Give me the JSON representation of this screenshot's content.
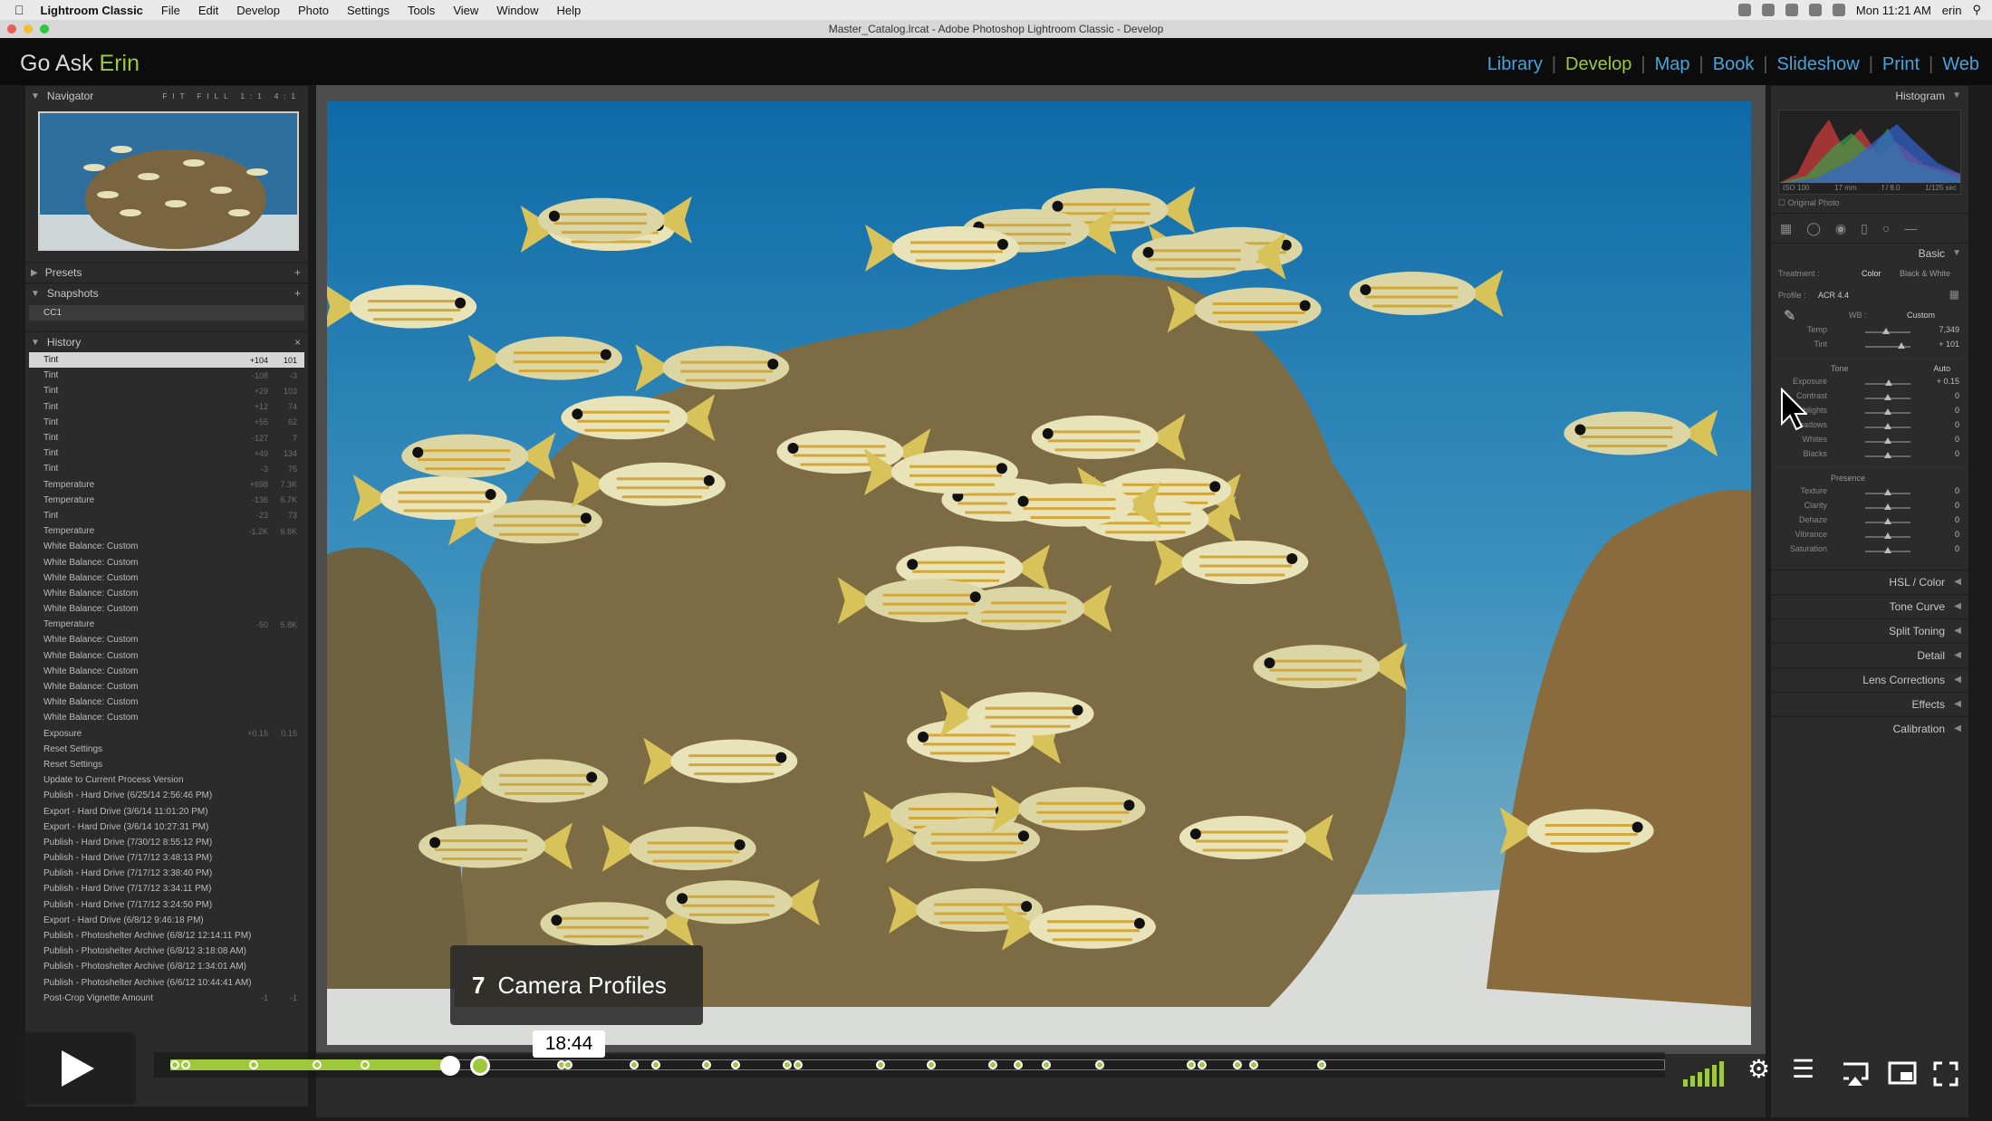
{
  "menubar": {
    "app_name": "Lightroom Classic",
    "items": [
      "File",
      "Edit",
      "Develop",
      "Photo",
      "Settings",
      "Tools",
      "View",
      "Window",
      "Help"
    ],
    "clock": "Mon 11:21 AM",
    "user": "erin"
  },
  "window_title": "Master_Catalog.lrcat - Adobe Photoshop Lightroom Classic - Develop",
  "brand": {
    "prefix": "Go Ask ",
    "accent": "Erin"
  },
  "modules": [
    "Library",
    "Develop",
    "Map",
    "Book",
    "Slideshow",
    "Print",
    "Web"
  ],
  "active_module": "Develop",
  "left_panel": {
    "navigator": {
      "title": "Navigator",
      "zoom_options": [
        "FIT",
        "FILL",
        "1:1",
        "4:1"
      ]
    },
    "presets_title": "Presets",
    "snapshots": {
      "title": "Snapshots",
      "items": [
        "CC1"
      ]
    },
    "history": {
      "title": "History",
      "items": [
        {
          "name": "Tint",
          "v1": "+104",
          "v2": "101"
        },
        {
          "name": "Tint",
          "v1": "-108",
          "v2": "-3"
        },
        {
          "name": "Tint",
          "v1": "+29",
          "v2": "103"
        },
        {
          "name": "Tint",
          "v1": "+12",
          "v2": "74"
        },
        {
          "name": "Tint",
          "v1": "+55",
          "v2": "62"
        },
        {
          "name": "Tint",
          "v1": "-127",
          "v2": "7"
        },
        {
          "name": "Tint",
          "v1": "+49",
          "v2": "134"
        },
        {
          "name": "Tint",
          "v1": "-3",
          "v2": "75"
        },
        {
          "name": "Temperature",
          "v1": "+698",
          "v2": "7.3K"
        },
        {
          "name": "Temperature",
          "v1": "-136",
          "v2": "6.7K"
        },
        {
          "name": "Tint",
          "v1": "-23",
          "v2": "73"
        },
        {
          "name": "Temperature",
          "v1": "-1.2K",
          "v2": "6.8K"
        },
        {
          "name": "White Balance: Custom",
          "v1": "",
          "v2": ""
        },
        {
          "name": "White Balance: Custom",
          "v1": "",
          "v2": ""
        },
        {
          "name": "White Balance: Custom",
          "v1": "",
          "v2": ""
        },
        {
          "name": "White Balance: Custom",
          "v1": "",
          "v2": ""
        },
        {
          "name": "White Balance: Custom",
          "v1": "",
          "v2": ""
        },
        {
          "name": "Temperature",
          "v1": "-50",
          "v2": "5.8K"
        },
        {
          "name": "White Balance: Custom",
          "v1": "",
          "v2": ""
        },
        {
          "name": "White Balance: Custom",
          "v1": "",
          "v2": ""
        },
        {
          "name": "White Balance: Custom",
          "v1": "",
          "v2": ""
        },
        {
          "name": "White Balance: Custom",
          "v1": "",
          "v2": ""
        },
        {
          "name": "White Balance: Custom",
          "v1": "",
          "v2": ""
        },
        {
          "name": "White Balance: Custom",
          "v1": "",
          "v2": ""
        },
        {
          "name": "Exposure",
          "v1": "+0.15",
          "v2": "0.15"
        },
        {
          "name": "Reset Settings",
          "v1": "",
          "v2": ""
        },
        {
          "name": "Reset Settings",
          "v1": "",
          "v2": ""
        },
        {
          "name": "Update to Current Process Version",
          "v1": "",
          "v2": ""
        },
        {
          "name": "Publish - Hard Drive (6/25/14 2:56:46 PM)",
          "v1": "",
          "v2": ""
        },
        {
          "name": "Export - Hard Drive (3/6/14 11:01:20 PM)",
          "v1": "",
          "v2": ""
        },
        {
          "name": "Export - Hard Drive (3/6/14 10:27:31 PM)",
          "v1": "",
          "v2": ""
        },
        {
          "name": "Publish - Hard Drive (7/30/12 8:55:12 PM)",
          "v1": "",
          "v2": ""
        },
        {
          "name": "Publish - Hard Drive (7/17/12 3:48:13 PM)",
          "v1": "",
          "v2": ""
        },
        {
          "name": "Publish - Hard Drive (7/17/12 3:38:40 PM)",
          "v1": "",
          "v2": ""
        },
        {
          "name": "Publish - Hard Drive (7/17/12 3:34:11 PM)",
          "v1": "",
          "v2": ""
        },
        {
          "name": "Publish - Hard Drive (7/17/12 3:24:50 PM)",
          "v1": "",
          "v2": ""
        },
        {
          "name": "Export - Hard Drive (6/8/12 9:46:18 PM)",
          "v1": "",
          "v2": ""
        },
        {
          "name": "Publish - Photoshelter Archive (6/8/12 12:14:11 PM)",
          "v1": "",
          "v2": ""
        },
        {
          "name": "Publish - Photoshelter Archive (6/8/12 3:18:08 AM)",
          "v1": "",
          "v2": ""
        },
        {
          "name": "Publish - Photoshelter Archive (6/8/12 1:34:01 AM)",
          "v1": "",
          "v2": ""
        },
        {
          "name": "Publish - Photoshelter Archive (6/6/12 10:44:41 AM)",
          "v1": "",
          "v2": ""
        },
        {
          "name": "Post-Crop Vignette Amount",
          "v1": "-1",
          "v2": "-1"
        }
      ]
    }
  },
  "right_panel": {
    "histogram_title": "Histogram",
    "histogram_info": [
      "ISO 100",
      "17 mm",
      "f / 8.0",
      "1/125 sec"
    ],
    "original_photo_label": "Original Photo",
    "basic_title": "Basic",
    "treatment_label": "Treatment :",
    "treatment_options": [
      "Color",
      "Black & White"
    ],
    "profile_label": "Profile :",
    "profile_value": "ACR 4.4",
    "wb_label": "WB :",
    "wb_value": "Custom",
    "wb_sliders": [
      {
        "label": "Temp",
        "value": "7,349",
        "pos": 0.45
      },
      {
        "label": "Tint",
        "value": "+ 101",
        "pos": 0.8
      }
    ],
    "tone_label": "Tone",
    "auto_label": "Auto",
    "tone_sliders": [
      {
        "label": "Exposure",
        "value": "+ 0.15",
        "pos": 0.52
      },
      {
        "label": "Contrast",
        "value": "0",
        "pos": 0.5
      },
      {
        "label": "Highlights",
        "value": "0",
        "pos": 0.5
      },
      {
        "label": "Shadows",
        "value": "0",
        "pos": 0.5
      },
      {
        "label": "Whites",
        "value": "0",
        "pos": 0.5
      },
      {
        "label": "Blacks",
        "value": "0",
        "pos": 0.5
      }
    ],
    "presence_label": "Presence",
    "presence_sliders": [
      {
        "label": "Texture",
        "value": "0",
        "pos": 0.5
      },
      {
        "label": "Clarity",
        "value": "0",
        "pos": 0.5
      },
      {
        "label": "Dehaze",
        "value": "0",
        "pos": 0.5
      },
      {
        "label": "Vibrance",
        "value": "0",
        "pos": 0.5
      },
      {
        "label": "Saturation",
        "value": "0",
        "pos": 0.5
      }
    ],
    "sections": [
      "HSL / Color",
      "Tone Curve",
      "Split Toning",
      "Detail",
      "Lens Corrections",
      "Effects",
      "Calibration"
    ]
  },
  "video": {
    "chapter_number": "7",
    "chapter_title": "Camera Profiles",
    "time_tooltip": "18:44",
    "played_fraction": 0.187,
    "hover_fraction": 0.207,
    "chapter_markers": [
      0.003,
      0.01,
      0.056,
      0.098,
      0.13,
      0.262,
      0.266,
      0.31,
      0.325,
      0.359,
      0.378,
      0.413,
      0.42,
      0.475,
      0.509,
      0.55,
      0.567,
      0.586,
      0.622,
      0.683,
      0.69,
      0.714,
      0.725,
      0.77
    ]
  }
}
